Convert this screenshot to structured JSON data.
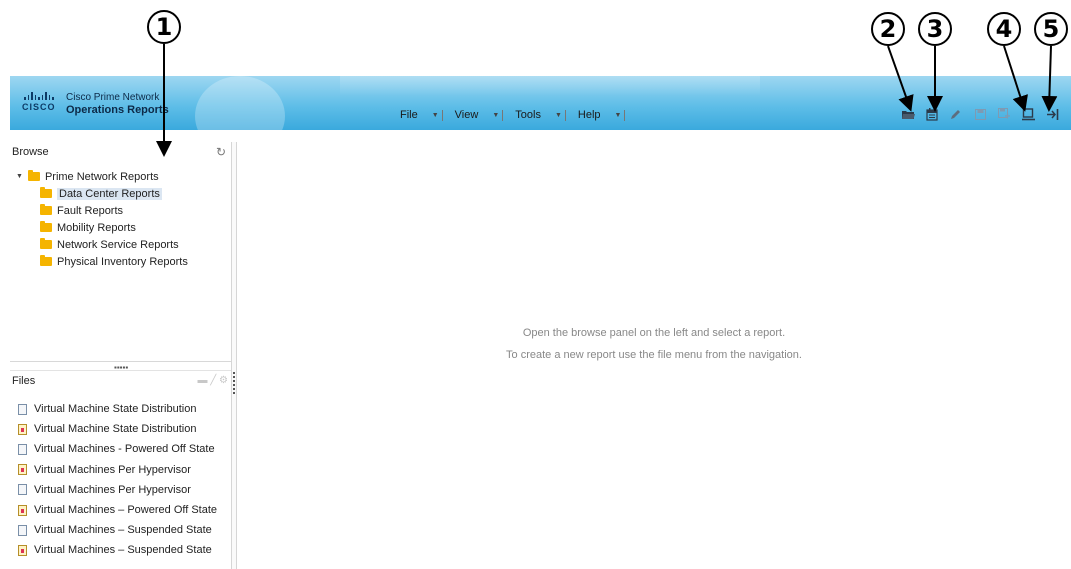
{
  "callouts": [
    "1",
    "2",
    "3",
    "4",
    "5"
  ],
  "header": {
    "product_line": "Cisco Prime Network",
    "app_name": "Operations Reports",
    "cisco_word": "CISCO"
  },
  "menu": [
    {
      "label": "File"
    },
    {
      "label": "View"
    },
    {
      "label": "Tools"
    },
    {
      "label": "Help"
    }
  ],
  "toolbar": {
    "icons": [
      "open-folder-icon",
      "schedule-icon",
      "edit-icon",
      "save-icon",
      "save-as-icon",
      "display-icon",
      "logout-icon"
    ]
  },
  "browse": {
    "title": "Browse",
    "refresh_icon": "↻",
    "root": "Prime Network Reports",
    "folders": [
      "Data Center Reports",
      "Fault Reports",
      "Mobility Reports",
      "Network Service Reports",
      "Physical Inventory Reports"
    ],
    "selected_index": 0
  },
  "files": {
    "title": "Files",
    "items": [
      {
        "name": "Virtual Machine State Distribution",
        "type": "definition"
      },
      {
        "name": "Virtual Machine State Distribution",
        "type": "report"
      },
      {
        "name": "Virtual Machines - Powered Off State",
        "type": "definition"
      },
      {
        "name": "Virtual Machines Per Hypervisor",
        "type": "report"
      },
      {
        "name": "Virtual Machines Per Hypervisor",
        "type": "definition"
      },
      {
        "name": "Virtual Machines – Powered Off State",
        "type": "report"
      },
      {
        "name": "Virtual Machines – Suspended State",
        "type": "definition"
      },
      {
        "name": "Virtual Machines – Suspended State",
        "type": "report"
      }
    ]
  },
  "main": {
    "line1": "Open the browse panel on the left and select a report.",
    "line2": "To create a new report use the file menu from the navigation."
  },
  "colors": {
    "header_top": "#9ed7f1",
    "header_bottom": "#3aa9dd",
    "folder": "#f5b400",
    "selection": "#dbe6f2"
  }
}
